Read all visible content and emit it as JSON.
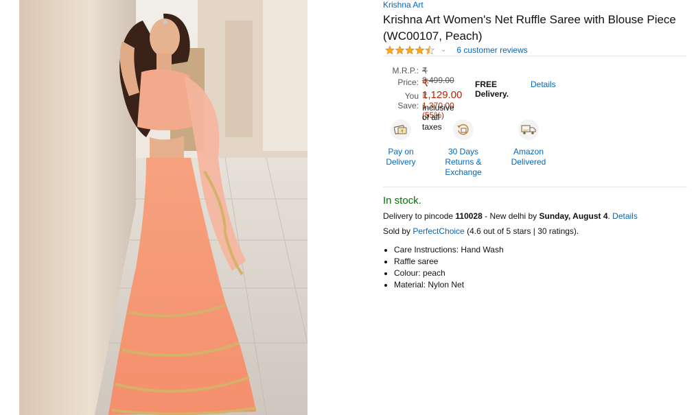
{
  "product": {
    "brand": "Krishna Art",
    "title": "Krishna Art Women's Net Ruffle Saree with Blouse Piece (WC00107, Peach)",
    "rating_stars": 4.5,
    "reviews_link": "6 customer reviews",
    "image_alt": "Woman in peach net ruffle saree"
  },
  "pricing": {
    "mrp_label": "M.R.P.:",
    "mrp_value": "₹ 2,499.00",
    "price_label": "Price:",
    "price_value": "₹ 1,129.00",
    "free_delivery": "FREE Delivery.",
    "details_link": "Details",
    "save_label": "You Save:",
    "save_value": "₹ 1,370.00 (55%)",
    "inclusive": "Inclusive of all taxes"
  },
  "features": [
    {
      "label_1": "Pay on",
      "label_2": "Delivery",
      "label_3": "",
      "icon": "pay-on-delivery-icon"
    },
    {
      "label_1": "30 Days",
      "label_2": "Returns &",
      "label_3": "Exchange",
      "icon": "returns-icon"
    },
    {
      "label_1": "Amazon",
      "label_2": "Delivered",
      "label_3": "",
      "icon": "truck-icon"
    }
  ],
  "availability": {
    "stock": "In stock.",
    "delivery_prefix": "Delivery to pincode ",
    "pincode": "110028",
    "delivery_mid": " - New delhi by ",
    "date": "Sunday, August 4",
    "delivery_suffix": ". ",
    "details_link": "Details",
    "sold_prefix": "Sold by ",
    "seller": "PerfectChoice",
    "seller_rating": " (4.6 out of 5 stars | 30 ratings)."
  },
  "bullets": [
    "Care Instructions: Hand Wash",
    "Raffle saree",
    "Colour: peach",
    "Material: Nylon Net"
  ],
  "colors": {
    "link": "#0066c0",
    "price": "#b12704",
    "in_stock": "#007600",
    "star": "#ffa41c"
  }
}
